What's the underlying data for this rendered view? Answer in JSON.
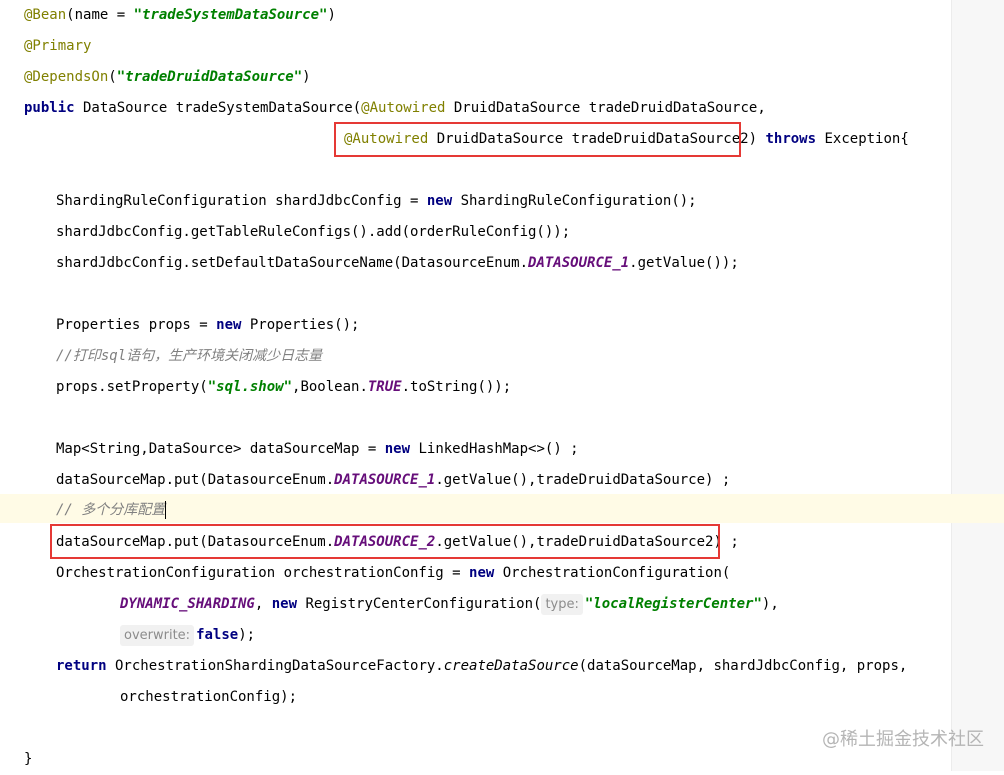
{
  "editor": {
    "line1": {
      "ann": "@Bean",
      "a": "(name = ",
      "str": "\"tradeSystemDataSource\"",
      "b": ")"
    },
    "line2": {
      "ann": "@Primary"
    },
    "line3": {
      "ann": "@DependsOn",
      "a": "(",
      "str": "\"tradeDruidDataSource\"",
      "b": ")"
    },
    "line4": {
      "kw": "public",
      "a": " DataSource tradeSystemDataSource(",
      "ann": "@Autowired",
      "b": " DruidDataSource tradeDruidDataSource,"
    },
    "line5": {
      "ann": "@Autowired",
      "a": " DruidDataSource tradeDruidDataSource2)",
      "kw": " throws",
      "b": " Exception{"
    },
    "line6": {
      "a": "ShardingRuleConfiguration shardJdbcConfig = ",
      "kw": "new",
      "b": " ShardingRuleConfiguration();"
    },
    "line7": {
      "a": "shardJdbcConfig.getTableRuleConfigs().add(orderRuleConfig());"
    },
    "line8": {
      "a": "shardJdbcConfig.setDefaultDataSourceName(DatasourceEnum.",
      "const": "DATASOURCE_1",
      "b": ".getValue());"
    },
    "line9": {
      "a": "Properties props = ",
      "kw": "new",
      "b": " Properties();"
    },
    "line10": {
      "comment": "//打印sql语句，生产环境关闭减少日志量"
    },
    "line11": {
      "a": "props.setProperty(",
      "str": "\"sql.show\"",
      "b": ",Boolean.",
      "const": "TRUE",
      "c": ".toString());"
    },
    "line12": {
      "a": "Map<String,DataSource> dataSourceMap = ",
      "kw": "new",
      "b": " LinkedHashMap<>() ;"
    },
    "line13": {
      "a": "dataSourceMap.put(DatasourceEnum.",
      "const": "DATASOURCE_1",
      "b": ".getValue(),tradeDruidDataSource) ;"
    },
    "line14": {
      "comment": "// 多个分库配置"
    },
    "line15": {
      "a": "dataSourceMap.put(DatasourceEnum.",
      "const": "DATASOURCE_2",
      "b": ".getValue(),tradeDruidDataSource2) ;"
    },
    "line16": {
      "a": "OrchestrationConfiguration orchestrationConfig = ",
      "kw": "new",
      "b": " OrchestrationConfiguration("
    },
    "line17": {
      "const": "DYNAMIC_SHARDING",
      "a": ", ",
      "kw": "new",
      "b": " RegistryCenterConfiguration(",
      "hint": "type:",
      "str": "\"localRegisterCenter\"",
      "c": "),"
    },
    "line18": {
      "hint": "overwrite:",
      "kw": "false",
      "a": ");"
    },
    "line19": {
      "kw": "return",
      "a": " OrchestrationShardingDataSourceFactory.",
      "italic": "createDataSource",
      "b": "(dataSourceMap, shardJdbcConfig, props,"
    },
    "line20": {
      "a": "orchestrationConfig);"
    },
    "line21": {
      "a": "}"
    }
  },
  "watermark": "@稀土掘金技术社区",
  "colors": {
    "annotation": "#808000",
    "keyword": "#000080",
    "string": "#008000",
    "constant": "#660e7a",
    "comment": "#808080",
    "highlight_box": "#e53935"
  }
}
